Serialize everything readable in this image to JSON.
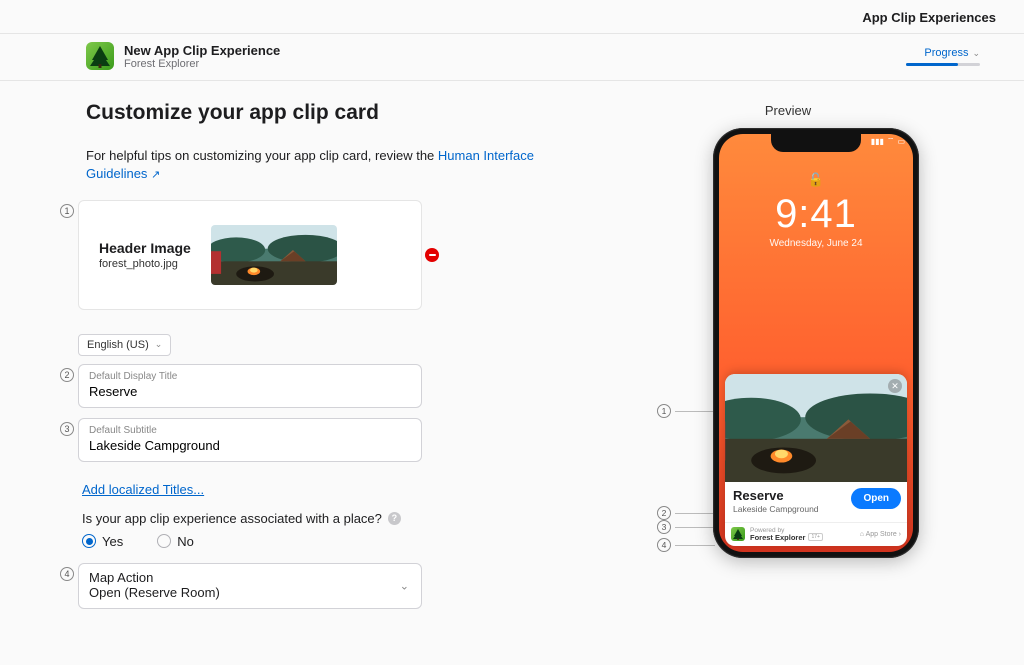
{
  "nav": {
    "section": "App Clip Experiences"
  },
  "header": {
    "title": "New App Clip Experience",
    "subtitle": "Forest Explorer",
    "progress_label": "Progress",
    "progress_pct": 70
  },
  "page": {
    "title": "Customize your app clip card",
    "intro_prefix": "For helpful tips on customizing your app clip card, review the ",
    "intro_link": "Human Interface Guidelines"
  },
  "form": {
    "header_image": {
      "label": "Header Image",
      "filename": "forest_photo.jpg"
    },
    "language": "English (US)",
    "display_title": {
      "label": "Default Display Title",
      "value": "Reserve"
    },
    "subtitle": {
      "label": "Default Subtitle",
      "value": "Lakeside Campground"
    },
    "add_localized": "Add localized Titles...",
    "place_question": "Is your app clip experience associated with a place?",
    "radio_yes": "Yes",
    "radio_no": "No",
    "map_action": {
      "label": "Map Action",
      "value": "Open (Reserve Room)"
    }
  },
  "preview": {
    "label": "Preview",
    "time": "9:41",
    "date": "Wednesday, June 24",
    "card_title": "Reserve",
    "card_subtitle": "Lakeside Campground",
    "open_label": "Open",
    "powered_by": "Powered by",
    "app_name": "Forest Explorer",
    "app_store": "App Store"
  },
  "steps": {
    "s1": "1",
    "s2": "2",
    "s3": "3",
    "s4": "4"
  }
}
